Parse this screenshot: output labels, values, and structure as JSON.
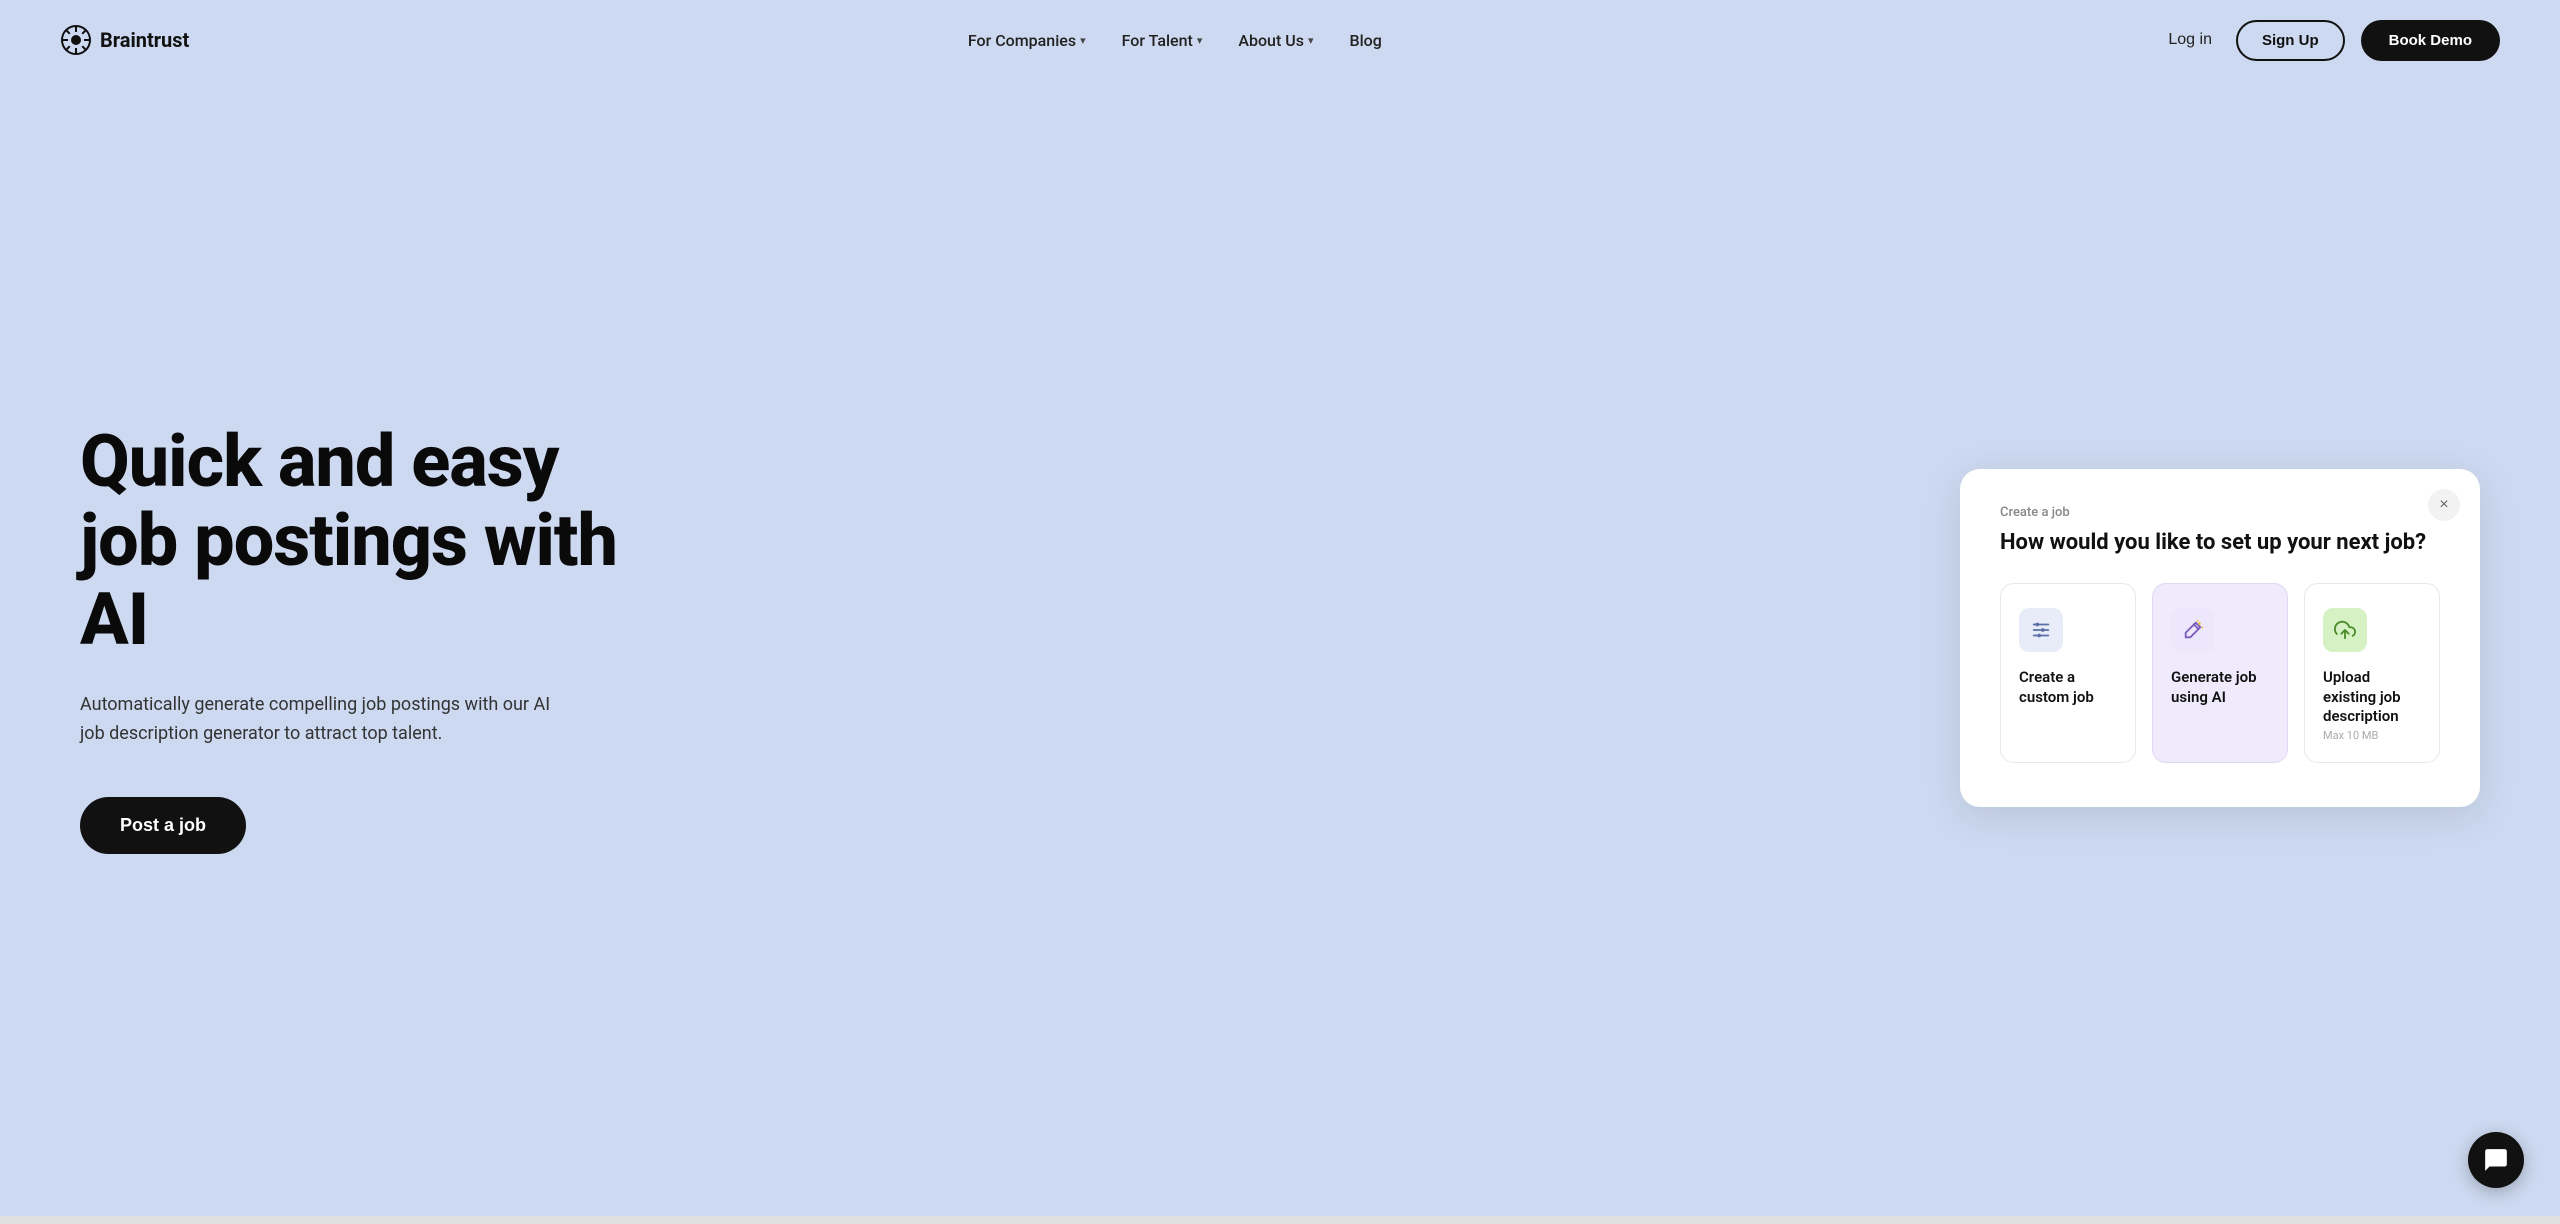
{
  "brand": {
    "name": "Braintrust"
  },
  "nav": {
    "links": [
      {
        "label": "For Companies",
        "hasDropdown": true,
        "id": "for-companies"
      },
      {
        "label": "For Talent",
        "hasDropdown": true,
        "id": "for-talent"
      },
      {
        "label": "About Us",
        "hasDropdown": true,
        "id": "about-us"
      },
      {
        "label": "Blog",
        "hasDropdown": false,
        "id": "blog"
      }
    ],
    "login_label": "Log in",
    "signup_label": "Sign Up",
    "book_demo_label": "Book Demo"
  },
  "hero": {
    "title": "Quick and easy job postings with AI",
    "subtitle": "Automatically generate compelling job postings with our AI job description generator to attract top talent.",
    "cta_label": "Post a job"
  },
  "card": {
    "eyebrow": "Create a job",
    "title": "How would you like to set up your next job?",
    "close_label": "×",
    "options": [
      {
        "id": "custom",
        "label": "Create a custom job",
        "sublabel": "",
        "icon_type": "sliders",
        "icon_color": "blue",
        "active": false
      },
      {
        "id": "ai",
        "label": "Generate job using AI",
        "sublabel": "",
        "icon_type": "ai-wand",
        "icon_color": "purple",
        "active": true
      },
      {
        "id": "upload",
        "label": "Upload existing job description",
        "sublabel": "Max 10 MB",
        "icon_type": "upload",
        "icon_color": "green",
        "active": false
      }
    ]
  }
}
